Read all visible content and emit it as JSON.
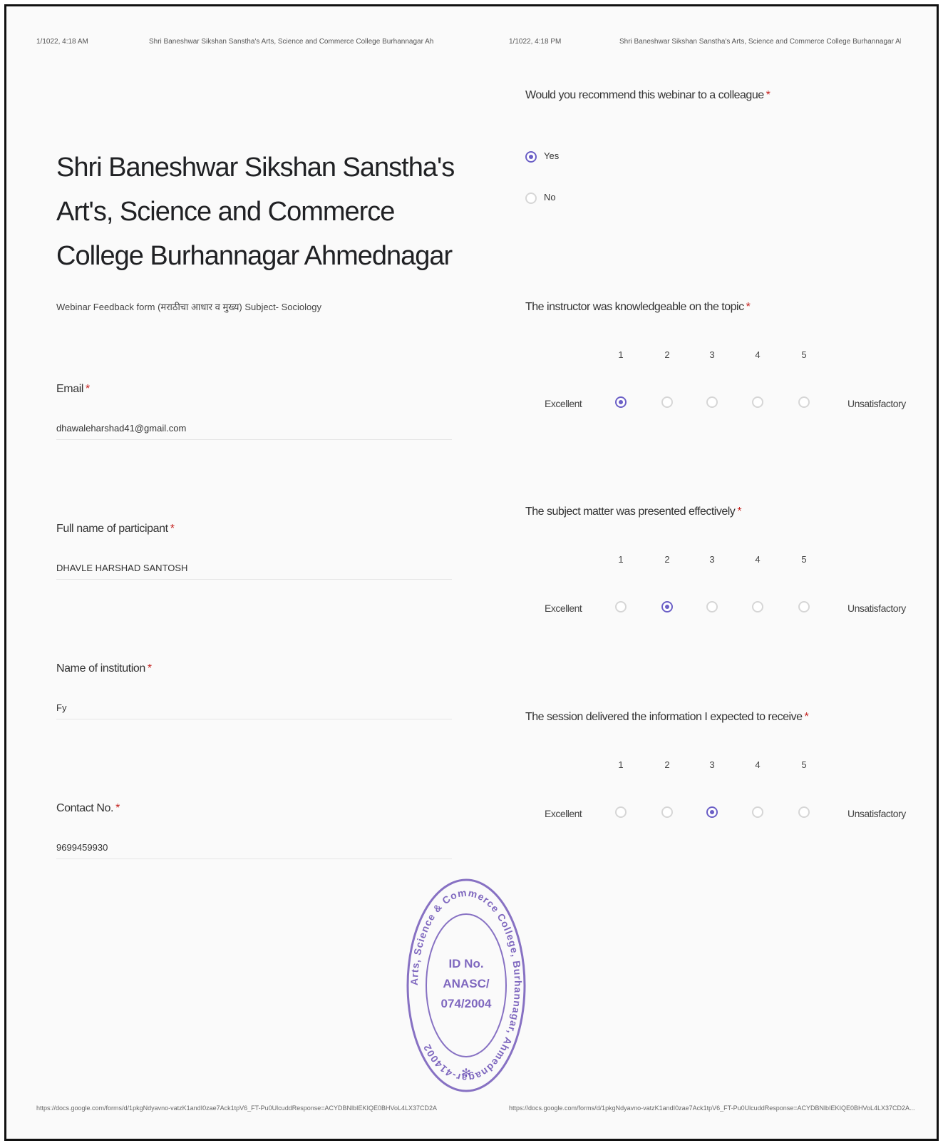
{
  "page1": {
    "header_date": "1/1022, 4:18 AM",
    "header_title": "Shri Baneshwar Sikshan Sanstha's Arts, Science and Commerce College Burhannagar Ahmednagar",
    "title": "Shri Baneshwar Sikshan Sanstha's Art's, Science and Commerce College Burhannagar Ahmednagar",
    "subtitle": "Webinar Feedback form (मराठीचा आधार व मुख्य) Subject- Sociology",
    "fields": [
      {
        "label": "Email",
        "value": "dhawaleharshad41@gmail.com"
      },
      {
        "label": "Full name of participant",
        "value": "DHAVLE HARSHAD SANTOSH"
      },
      {
        "label": "Name of institution",
        "value": "Fy"
      },
      {
        "label": "Contact No.",
        "value": "9699459930"
      }
    ],
    "footer_url": "https://docs.google.com/forms/d/1pkgNdyavno-vatzK1andI0zae7Ack1tpV6_FT-Pu0UlcuddResponse=ACYDBNlbIEKIQE0BHVoL4LX37CD2A"
  },
  "page2": {
    "header_date": "1/1022, 4:18 PM",
    "header_title": "Shri Baneshwar Sikshan Sanstha's Arts, Science and Commerce College Burhannagar Ahmednagar",
    "recommend": {
      "question": "Would you recommend this webinar to a colleague",
      "options": [
        "Yes",
        "No"
      ],
      "selected": "Yes"
    },
    "scale_questions": [
      {
        "question": "The instructor was knowledgeable on the topic",
        "selected": 1
      },
      {
        "question": "The subject matter was presented effectively",
        "selected": 2
      },
      {
        "question": "The session delivered the information I expected to receive",
        "selected": 3
      }
    ],
    "scale_numbers": [
      "1",
      "2",
      "3",
      "4",
      "5"
    ],
    "scale_low_label": "Excellent",
    "scale_high_label": "Unsatisfactory",
    "footer_url": "https://docs.google.com/forms/d/1pkgNdyavno-vatzK1andI0zae7Ack1tpV6_FT-Pu0UlcuddResponse=ACYDBNlbIEKIQE0BHVoL4LX37CD2A..."
  },
  "stamp": {
    "ring_text": "Arts, Science & Commerce College, Burhannagar, Ahmednagar-414002",
    "center_lines": [
      "ID No.",
      "ANASC/",
      "074/2004"
    ],
    "star": "✻"
  },
  "required_marker": "*",
  "colors": {
    "accent": "#6b5fc6",
    "required": "#c5221f",
    "stamp": "#6a4fb5"
  }
}
